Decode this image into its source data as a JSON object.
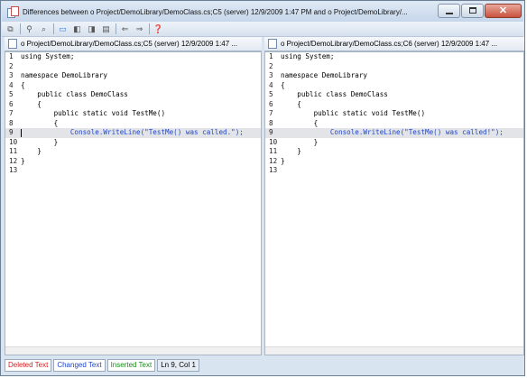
{
  "window": {
    "title": "Differences between o Project/DemoLibrary/DemoClass.cs;C5  (server)   12/9/2009 1:47 PM and o Project/DemoLibrary/..."
  },
  "left_pane": {
    "header": "o Project/DemoLibrary/DemoClass.cs;C5  (server)   12/9/2009 1:47 ...",
    "lines": [
      {
        "num": "1",
        "code": "using System;"
      },
      {
        "num": "2",
        "code": ""
      },
      {
        "num": "3",
        "code": "namespace DemoLibrary"
      },
      {
        "num": "4",
        "code": "{"
      },
      {
        "num": "5",
        "code": "    public class DemoClass"
      },
      {
        "num": "6",
        "code": "    {"
      },
      {
        "num": "7",
        "code": "        public static void TestMe()"
      },
      {
        "num": "8",
        "code": "        {"
      },
      {
        "num": "9",
        "code": "            Console.WriteLine(\"TestMe() was called.\");"
      },
      {
        "num": "10",
        "code": "        }"
      },
      {
        "num": "11",
        "code": "    }"
      },
      {
        "num": "12",
        "code": "}"
      },
      {
        "num": "13",
        "code": ""
      }
    ]
  },
  "right_pane": {
    "header": "o Project/DemoLibrary/DemoClass.cs;C6  (server)   12/9/2009 1:47 ...",
    "lines": [
      {
        "num": "1",
        "code": "using System;"
      },
      {
        "num": "2",
        "code": ""
      },
      {
        "num": "3",
        "code": "namespace DemoLibrary"
      },
      {
        "num": "4",
        "code": "{"
      },
      {
        "num": "5",
        "code": "    public class DemoClass"
      },
      {
        "num": "6",
        "code": "    {"
      },
      {
        "num": "7",
        "code": "        public static void TestMe()"
      },
      {
        "num": "8",
        "code": "        {"
      },
      {
        "num": "9",
        "code": "            Console.WriteLine(\"TestMe() was called!\");"
      },
      {
        "num": "10",
        "code": "        }"
      },
      {
        "num": "11",
        "code": "    }"
      },
      {
        "num": "12",
        "code": "}"
      },
      {
        "num": "13",
        "code": ""
      }
    ]
  },
  "changed_line_index": 8,
  "legend": {
    "deleted": "Deleted Text",
    "changed": "Changed Text",
    "inserted": "Inserted Text",
    "position": "Ln 9, Col 1"
  },
  "colors": {
    "deleted": "#d21f1f",
    "changed": "#1f46c8",
    "inserted": "#1d8a1d",
    "changed_line_bg": "#e3e4e8"
  },
  "toolbar_icons": [
    "copy-icon",
    "find-icon",
    "find-next-icon",
    "compare-icon",
    "previous-difference-icon",
    "next-difference-icon",
    "comment-icon",
    "back-icon",
    "forward-icon",
    "help-icon"
  ]
}
